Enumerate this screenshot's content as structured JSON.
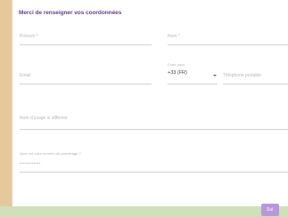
{
  "form": {
    "title": "Merci de renseigner vos coordonnées",
    "prenom_label": "Prénom *",
    "nom_label": "Nom *",
    "email_label": "Email",
    "code_pays_label": "Code pays",
    "code_pays_value": "+33 (FR)",
    "telephone_label": "Téléphone portable",
    "nom_usage_label": "Nom d'usage si différent",
    "referral_label": "Quel est votre numéro de parrainage ?",
    "referral_value": "------------",
    "submit_label": "Sui"
  }
}
